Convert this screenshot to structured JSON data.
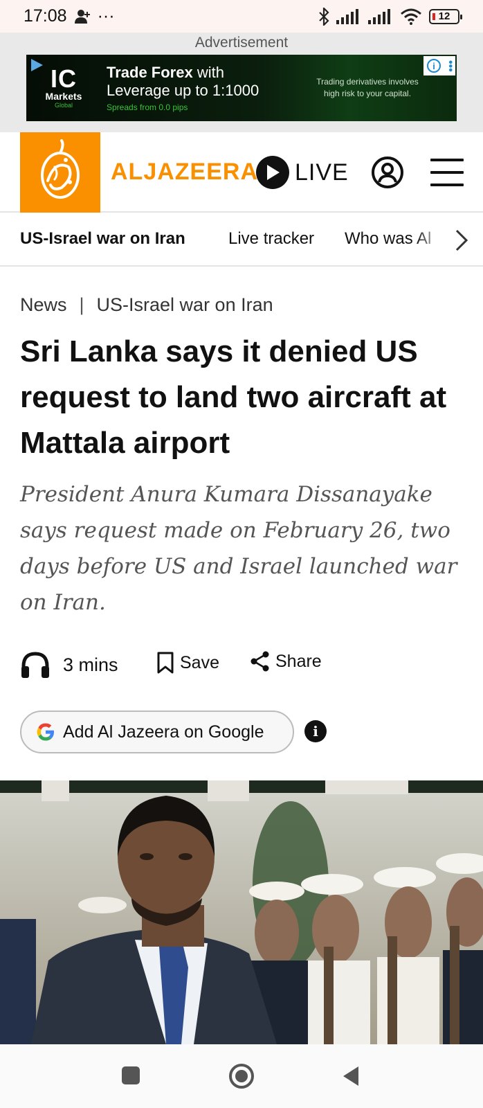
{
  "status_bar": {
    "time": "17:08",
    "more": "···",
    "battery": "12"
  },
  "ad": {
    "label": "Advertisement",
    "brand_short": "IC",
    "brand_name": "Markets",
    "brand_sub": "Global",
    "headline_bold": "Trade Forex",
    "headline_rest": " with",
    "leverage": "Leverage up to 1:1000",
    "spreads": "Spreads from 0.0 pips",
    "risk": "Trading derivatives involves high risk to your capital."
  },
  "header": {
    "brand": "ALJAZEERA",
    "live_label": "LIVE"
  },
  "topic_nav": {
    "items": [
      {
        "label": "US-Israel war on Iran",
        "active": true
      },
      {
        "label": "Live tracker",
        "active": false
      },
      {
        "label": "Who was Al",
        "active": false
      }
    ]
  },
  "article": {
    "category": "News",
    "topic": "US-Israel war on Iran",
    "headline": "Sri Lanka says it denied US request to land two aircraft at Mattala airport",
    "standfirst": "President Anura Kumara Dissanayake says request made on February 26, two days before US and Israel launched war on Iran.",
    "listen_label": "3 mins",
    "save_label": "Save",
    "share_label": "Share",
    "google_label": "Add Al Jazeera on Google",
    "info_label": "i"
  },
  "colors": {
    "brand_orange": "#fa9000",
    "text": "#111111",
    "standfirst": "#555555"
  }
}
